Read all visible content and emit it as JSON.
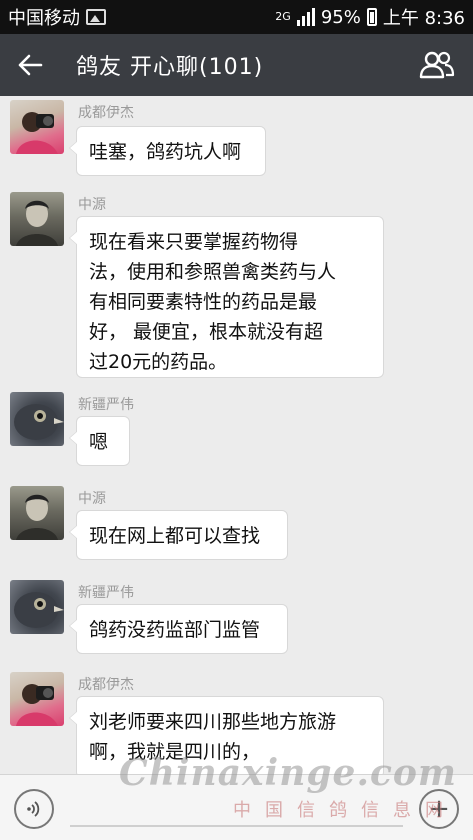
{
  "status_bar": {
    "carrier": "中国移动",
    "network": "2G",
    "battery": "95%",
    "time": "上午 8:36"
  },
  "nav": {
    "title": "鸽友 开心聊(101)"
  },
  "messages": [
    {
      "sender": "成都伊杰",
      "avatar": "avatar-chengdu",
      "lines": [
        "哇塞，鸽药坑人啊"
      ]
    },
    {
      "sender": "中源",
      "avatar": "avatar-zhongyuan",
      "lines": [
        "现在看来只要掌握药物得",
        "法，使用和参照兽禽类药与人",
        "有相同要素特性的药品是最",
        "好， 最便宜，根本就没有超",
        "过20元的药品。"
      ]
    },
    {
      "sender": "新疆严伟",
      "avatar": "avatar-pigeon",
      "lines": [
        "嗯"
      ]
    },
    {
      "sender": "中源",
      "avatar": "avatar-zhongyuan",
      "lines": [
        "现在网上都可以查找"
      ]
    },
    {
      "sender": "新疆严伟",
      "avatar": "avatar-pigeon",
      "lines": [
        "鸽药没药监部门监管"
      ]
    },
    {
      "sender": "成都伊杰",
      "avatar": "avatar-chengdu",
      "lines": [
        "刘老师要来四川那些地方旅游",
        "啊，我就是四川的，"
      ]
    }
  ],
  "watermark": {
    "en": "Chinaxinge.com",
    "cn": "中国信鸽信息网"
  },
  "icons": [
    "back-arrow-icon",
    "group-members-icon",
    "voice-icon",
    "plus-icon"
  ]
}
